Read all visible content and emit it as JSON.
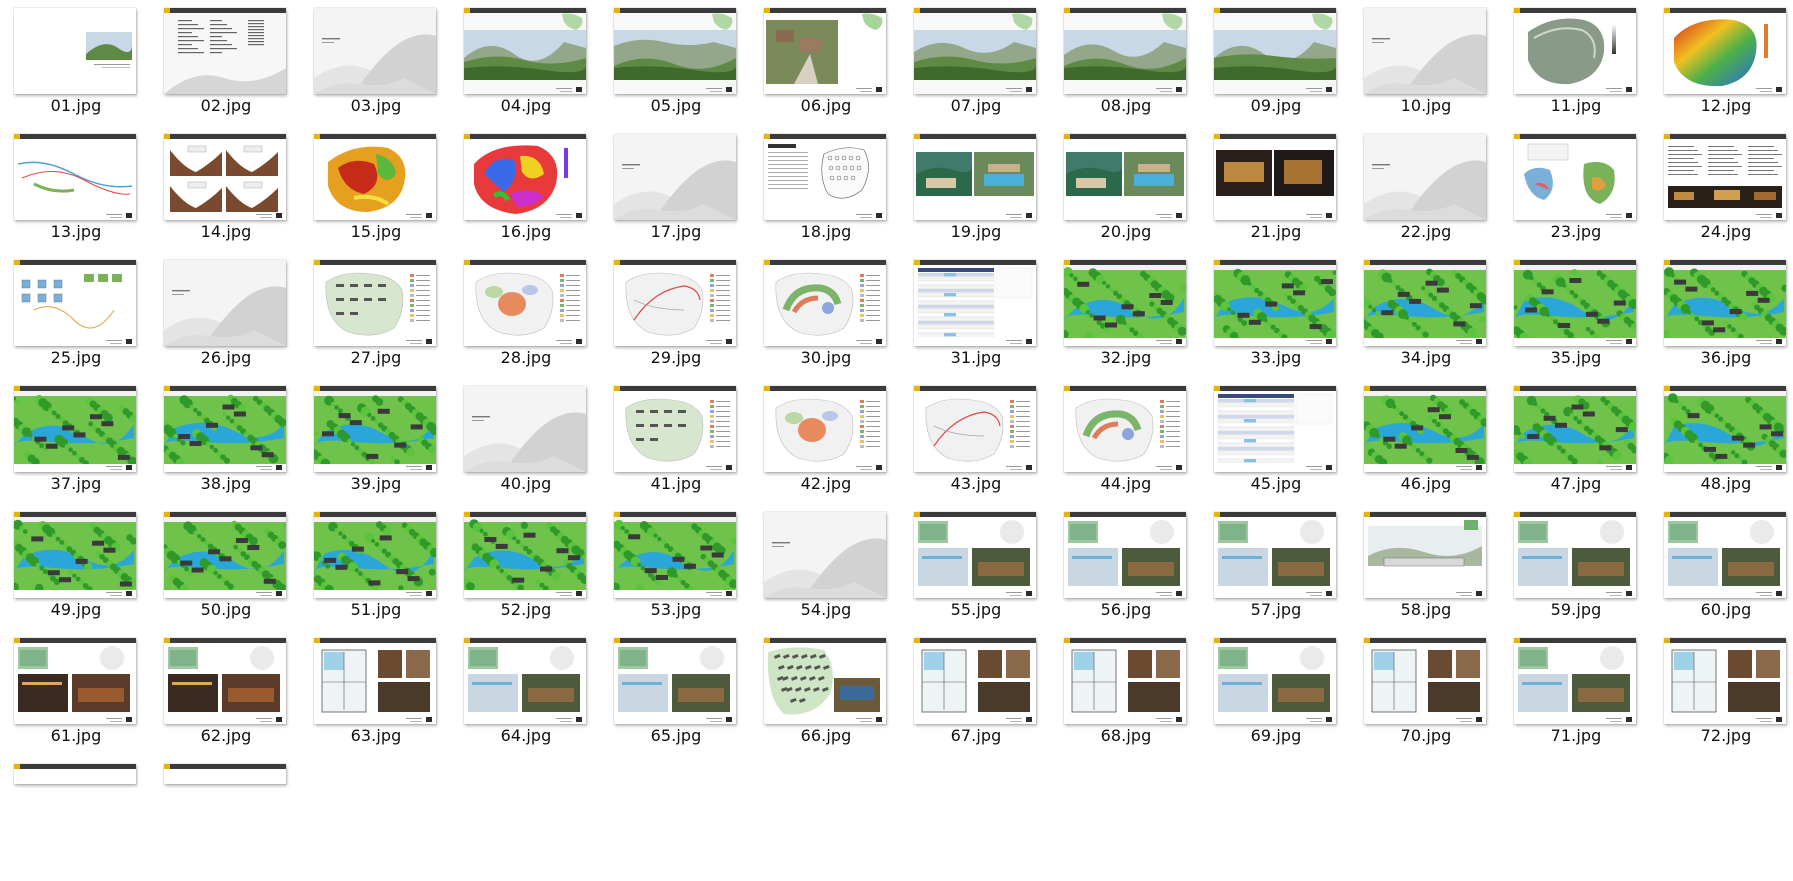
{
  "view": "thumbnails",
  "files": [
    {
      "name": "01.jpg",
      "kind": "cover"
    },
    {
      "name": "02.jpg",
      "kind": "contents"
    },
    {
      "name": "03.jpg",
      "kind": "divider"
    },
    {
      "name": "04.jpg",
      "kind": "photo-landscape"
    },
    {
      "name": "05.jpg",
      "kind": "photo-landscape"
    },
    {
      "name": "06.jpg",
      "kind": "photo-village"
    },
    {
      "name": "07.jpg",
      "kind": "photo-landscape"
    },
    {
      "name": "08.jpg",
      "kind": "photo-landscape"
    },
    {
      "name": "09.jpg",
      "kind": "photo-landscape"
    },
    {
      "name": "10.jpg",
      "kind": "divider"
    },
    {
      "name": "11.jpg",
      "kind": "terrain-gray"
    },
    {
      "name": "12.jpg",
      "kind": "terrain-heat"
    },
    {
      "name": "13.jpg",
      "kind": "route-map"
    },
    {
      "name": "14.jpg",
      "kind": "sections"
    },
    {
      "name": "15.jpg",
      "kind": "slope-map"
    },
    {
      "name": "16.jpg",
      "kind": "aspect-map"
    },
    {
      "name": "17.jpg",
      "kind": "divider"
    },
    {
      "name": "18.jpg",
      "kind": "table-plan"
    },
    {
      "name": "19.jpg",
      "kind": "photo-resort"
    },
    {
      "name": "20.jpg",
      "kind": "photo-resort"
    },
    {
      "name": "21.jpg",
      "kind": "photo-night"
    },
    {
      "name": "22.jpg",
      "kind": "divider"
    },
    {
      "name": "23.jpg",
      "kind": "analysis"
    },
    {
      "name": "24.jpg",
      "kind": "text-photos"
    },
    {
      "name": "25.jpg",
      "kind": "diagram"
    },
    {
      "name": "26.jpg",
      "kind": "divider"
    },
    {
      "name": "27.jpg",
      "kind": "masterplan"
    },
    {
      "name": "28.jpg",
      "kind": "zoning"
    },
    {
      "name": "29.jpg",
      "kind": "circulation"
    },
    {
      "name": "30.jpg",
      "kind": "zoning2"
    },
    {
      "name": "31.jpg",
      "kind": "spreadsheet"
    },
    {
      "name": "32.jpg",
      "kind": "aerial-render"
    },
    {
      "name": "33.jpg",
      "kind": "aerial-render"
    },
    {
      "name": "34.jpg",
      "kind": "aerial-render"
    },
    {
      "name": "35.jpg",
      "kind": "aerial-render"
    },
    {
      "name": "36.jpg",
      "kind": "aerial-render"
    },
    {
      "name": "37.jpg",
      "kind": "aerial-render"
    },
    {
      "name": "38.jpg",
      "kind": "aerial-render"
    },
    {
      "name": "39.jpg",
      "kind": "aerial-render"
    },
    {
      "name": "40.jpg",
      "kind": "divider"
    },
    {
      "name": "41.jpg",
      "kind": "masterplan"
    },
    {
      "name": "42.jpg",
      "kind": "zoning"
    },
    {
      "name": "43.jpg",
      "kind": "circulation"
    },
    {
      "name": "44.jpg",
      "kind": "zoning2"
    },
    {
      "name": "45.jpg",
      "kind": "spreadsheet"
    },
    {
      "name": "46.jpg",
      "kind": "aerial-render"
    },
    {
      "name": "47.jpg",
      "kind": "aerial-render"
    },
    {
      "name": "48.jpg",
      "kind": "aerial-render"
    },
    {
      "name": "49.jpg",
      "kind": "aerial-render"
    },
    {
      "name": "50.jpg",
      "kind": "aerial-render"
    },
    {
      "name": "51.jpg",
      "kind": "aerial-render"
    },
    {
      "name": "52.jpg",
      "kind": "aerial-render"
    },
    {
      "name": "53.jpg",
      "kind": "aerial-render"
    },
    {
      "name": "54.jpg",
      "kind": "divider"
    },
    {
      "name": "55.jpg",
      "kind": "plan-photos"
    },
    {
      "name": "56.jpg",
      "kind": "plan-photos"
    },
    {
      "name": "57.jpg",
      "kind": "plan-photos"
    },
    {
      "name": "58.jpg",
      "kind": "elevation"
    },
    {
      "name": "59.jpg",
      "kind": "plan-photos"
    },
    {
      "name": "60.jpg",
      "kind": "plan-photos"
    },
    {
      "name": "61.jpg",
      "kind": "plan-photos-dark"
    },
    {
      "name": "62.jpg",
      "kind": "plan-photos-dark"
    },
    {
      "name": "63.jpg",
      "kind": "floorplan"
    },
    {
      "name": "64.jpg",
      "kind": "plan-photos"
    },
    {
      "name": "65.jpg",
      "kind": "plan-photos"
    },
    {
      "name": "66.jpg",
      "kind": "site-plan"
    },
    {
      "name": "67.jpg",
      "kind": "floorplan"
    },
    {
      "name": "68.jpg",
      "kind": "floorplan"
    },
    {
      "name": "69.jpg",
      "kind": "plan-photos"
    },
    {
      "name": "70.jpg",
      "kind": "floorplan"
    },
    {
      "name": "71.jpg",
      "kind": "plan-photos"
    },
    {
      "name": "72.jpg",
      "kind": "floorplan"
    },
    {
      "name": "",
      "kind": "partial"
    },
    {
      "name": "",
      "kind": "partial"
    }
  ]
}
